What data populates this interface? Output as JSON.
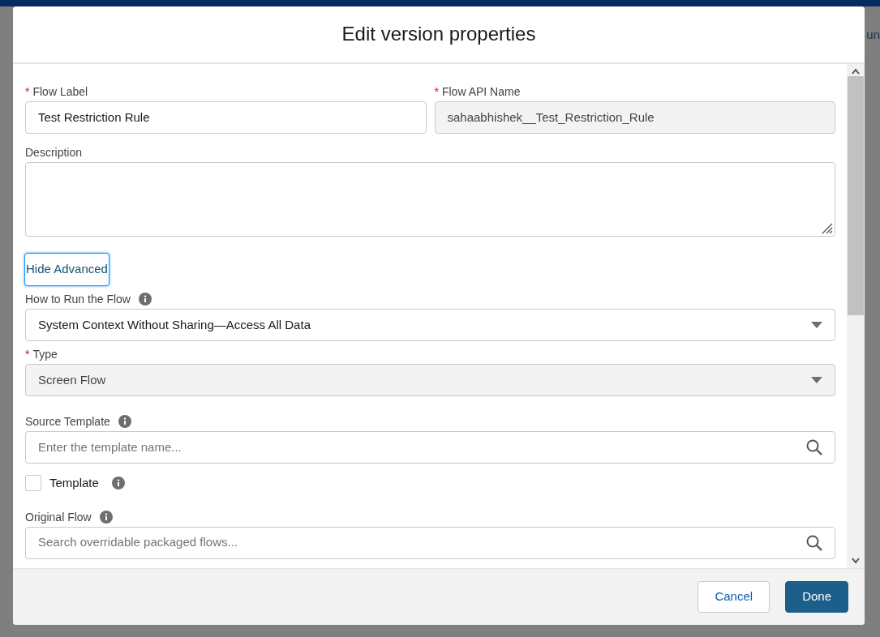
{
  "background": {
    "partial_text": "un"
  },
  "modal": {
    "title": "Edit version properties",
    "name_fields": [
      {
        "kind": "text",
        "required_mark": "*",
        "label": "Flow Label",
        "value": "Test Restriction Rule",
        "disabled": false
      },
      {
        "kind": "text",
        "required_mark": "*",
        "label": "Flow API Name",
        "value": "sahaabhishek__Test_Restriction_Rule",
        "disabled": true
      }
    ],
    "description": {
      "kind": "textarea",
      "label": "Description"
    },
    "advanced_button": "Hide Advanced",
    "fields": [
      {
        "kind": "select",
        "label": "How to Run the Flow",
        "info": true,
        "value": "System Context Without Sharing—Access All Data",
        "disabled": false
      },
      {
        "kind": "select",
        "required_mark": "*",
        "label": "Type",
        "info": false,
        "value": "Screen Flow",
        "disabled": true
      },
      {
        "kind": "search",
        "label": "Source Template",
        "info": true,
        "placeholder": "Enter the template name..."
      },
      {
        "kind": "checkbox",
        "label": "Template",
        "info": true,
        "checked": false
      },
      {
        "kind": "search",
        "label": "Original Flow",
        "info": true,
        "placeholder": "Search overridable packaged flows..."
      }
    ],
    "buttons": [
      {
        "label": "Cancel",
        "kind": "neutral"
      },
      {
        "label": "Done",
        "kind": "brand"
      }
    ]
  }
}
